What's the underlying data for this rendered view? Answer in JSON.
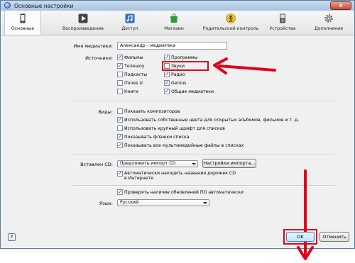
{
  "window": {
    "title": "Основные настройки",
    "close": "x"
  },
  "tabs": [
    {
      "label": "Основные",
      "icon": "iphone-icon"
    },
    {
      "label": "Воспроизведение",
      "icon": "play-icon"
    },
    {
      "label": "Доступ",
      "icon": "music-share-icon"
    },
    {
      "label": "Магазин",
      "icon": "store-bag-icon"
    },
    {
      "label": "Родительский контроль",
      "icon": "parental-control-icon"
    },
    {
      "label": "Устройства",
      "icon": "device-icon"
    },
    {
      "label": "Дополнения",
      "icon": "gear-icon"
    }
  ],
  "library": {
    "label": "Имя медиатеки:",
    "value": "Александр - медиатека"
  },
  "sources": {
    "label": "Источники:",
    "left": [
      {
        "label": "Фильмы",
        "checked": true
      },
      {
        "label": "Телешоу",
        "checked": true
      },
      {
        "label": "Подкасты",
        "checked": false
      },
      {
        "label": "iTunes U",
        "checked": false
      },
      {
        "label": "Книги",
        "checked": false
      }
    ],
    "right": [
      {
        "label": "Программы",
        "checked": true
      },
      {
        "label": "Звуки",
        "checked": false
      },
      {
        "label": "Радио",
        "checked": true
      },
      {
        "label": "Genius",
        "checked": true
      },
      {
        "label": "Общие медиатеки",
        "checked": true
      }
    ]
  },
  "views": {
    "label": "Виды:",
    "items": [
      {
        "label": "Показать композиторов",
        "checked": false
      },
      {
        "label": "Использовать собственные цвета для открытых альбомов, фильмов и т. д.",
        "checked": true
      },
      {
        "label": "Использовать крупный шрифт для списков",
        "checked": false
      },
      {
        "label": "Показывать флажки списка",
        "checked": true
      },
      {
        "label": "Показывать все мультимедийные файлы в списках",
        "checked": true
      }
    ]
  },
  "cd": {
    "label": "Вставлен CD:",
    "select": "Предложить импорт CD",
    "import_button": "Настройки импорта...",
    "auto_names": "Автоматически находить названия дорожек CD в Интернете",
    "auto_names_checked": true
  },
  "updates": {
    "label": "Проверять наличие обновлений ПО автоматически",
    "checked": true
  },
  "language": {
    "label": "Язык:",
    "value": "Русский"
  },
  "footer": {
    "help": "?",
    "ok": "OK",
    "cancel": "Отменить"
  },
  "colors": {
    "annotation": "#e0001b",
    "title_bar": "#b4cce6"
  }
}
